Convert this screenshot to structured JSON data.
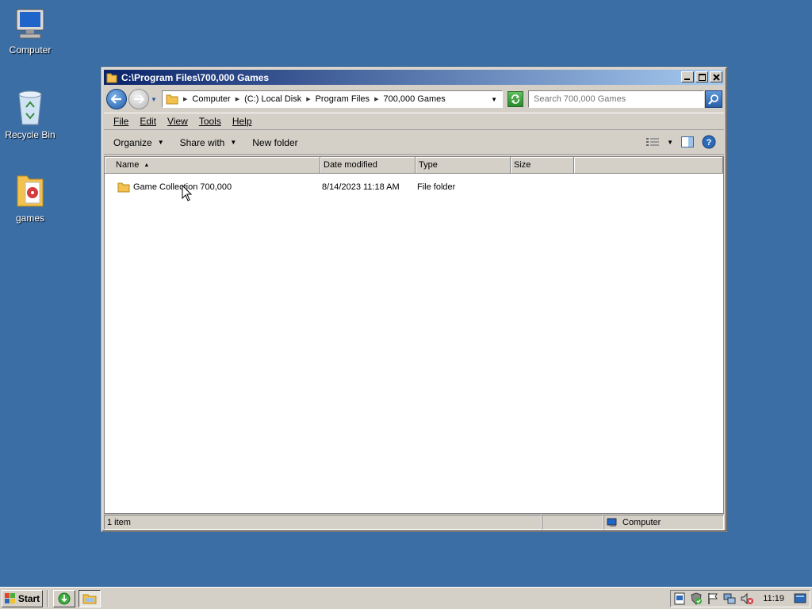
{
  "desktop": {
    "icons": [
      {
        "label": "Computer",
        "icon": "computer-icon"
      },
      {
        "label": "Recycle Bin",
        "icon": "recycle-bin-icon"
      },
      {
        "label": "games",
        "icon": "folder-icon"
      }
    ]
  },
  "window": {
    "title": "C:\\Program Files\\700,000 Games",
    "address": {
      "crumbs": [
        "Computer",
        "(C:) Local Disk",
        "Program Files",
        "700,000 Games"
      ]
    },
    "search": {
      "placeholder": "Search 700,000 Games"
    },
    "menu": [
      "File",
      "Edit",
      "View",
      "Tools",
      "Help"
    ],
    "commands": {
      "organize": "Organize",
      "share": "Share with",
      "new_folder": "New folder"
    },
    "columns": {
      "name": "Name",
      "date": "Date modified",
      "type": "Type",
      "size": "Size"
    },
    "rows": [
      {
        "name": "Game Collection 700,000",
        "date": "8/14/2023 11:18 AM",
        "type": "File folder",
        "size": ""
      }
    ],
    "status": {
      "count": "1 item",
      "location": "Computer"
    }
  },
  "taskbar": {
    "start": "Start",
    "clock": "11:19"
  },
  "colors": {
    "desktop": "#3a6ea5",
    "title_gradient_start": "#0a246a",
    "title_gradient_end": "#a6caf0"
  }
}
